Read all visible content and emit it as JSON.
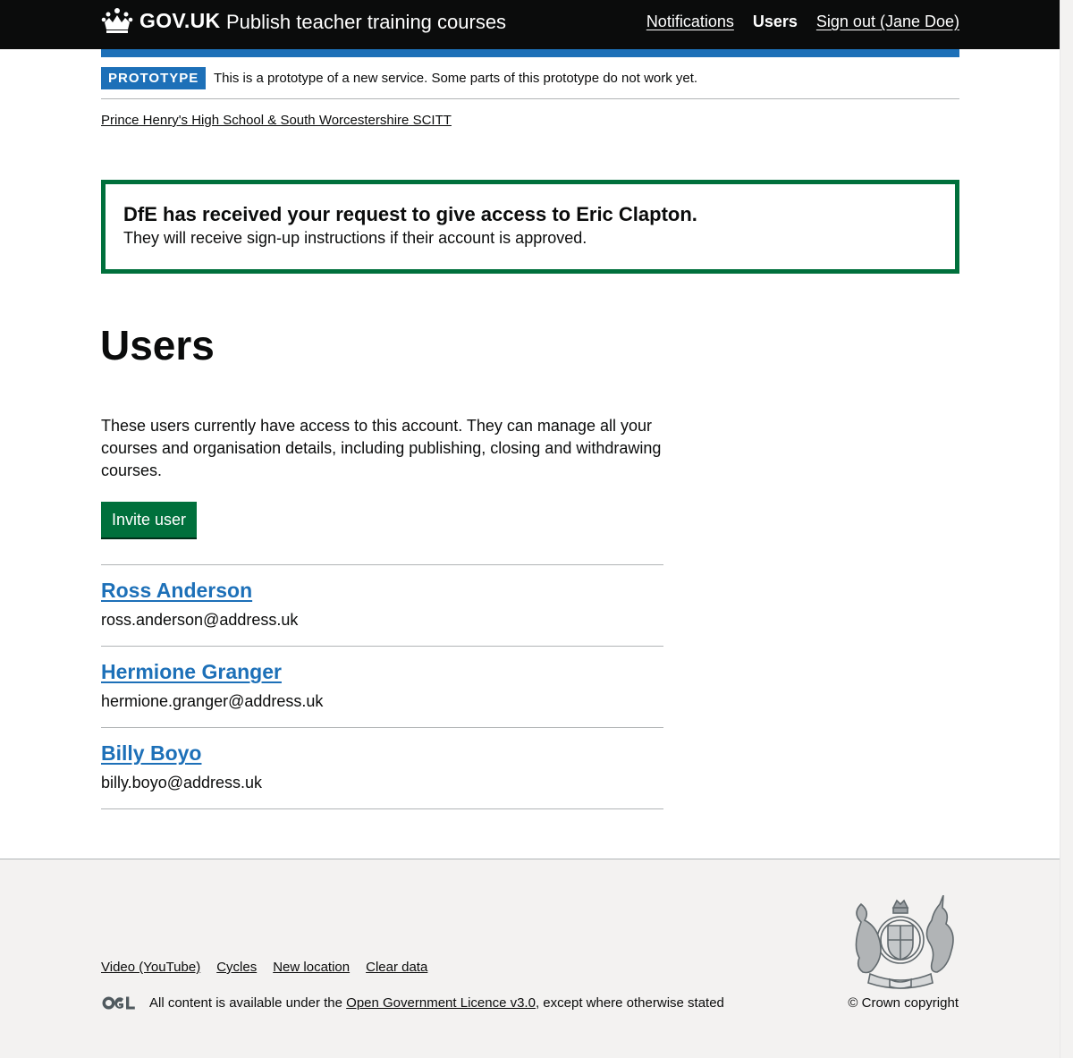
{
  "header": {
    "logo_text": "GOV.UK",
    "service_name": "Publish teacher training courses",
    "nav": [
      {
        "label": "Notifications",
        "active": false
      },
      {
        "label": "Users",
        "active": true
      },
      {
        "label": "Sign out (Jane Doe)",
        "active": false
      }
    ]
  },
  "phase_banner": {
    "tag": "PROTOTYPE",
    "text": "This is a prototype of a new service. Some parts of this prototype do not work yet."
  },
  "breadcrumb": "Prince Henry's High School & South Worcestershire SCITT",
  "notification": {
    "title": "DfE has received your request to give access to Eric Clapton.",
    "body": "They will receive sign-up instructions if their account is approved."
  },
  "main": {
    "title": "Users",
    "intro": "These users currently have access to this account. They can manage all your courses and organisation details, including publishing, closing and withdrawing courses.",
    "invite_button": "Invite user",
    "users": [
      {
        "name": "Ross Anderson",
        "email": "ross.anderson@address.uk"
      },
      {
        "name": "Hermione Granger",
        "email": "hermione.granger@address.uk"
      },
      {
        "name": "Billy Boyo",
        "email": "billy.boyo@address.uk"
      }
    ]
  },
  "footer": {
    "links": [
      "Video (YouTube)",
      "Cycles",
      "New location",
      "Clear data"
    ],
    "licence_prefix": "All content is available under the",
    "licence_link": "Open Government Licence v3.0",
    "licence_suffix": ", except where otherwise stated",
    "copyright": "© Crown copyright",
    "logo_lettering": [
      "OGL",
      "DIEU ET MON DROIT"
    ]
  },
  "colors": {
    "header_bg": "#0b0c0c",
    "brand_blue": "#1d70b8",
    "success_green": "#00703c",
    "footer_bg": "#f3f2f1"
  },
  "icons": [
    "crown-icon",
    "ogl-icon",
    "royal-coat-of-arms-icon"
  ]
}
